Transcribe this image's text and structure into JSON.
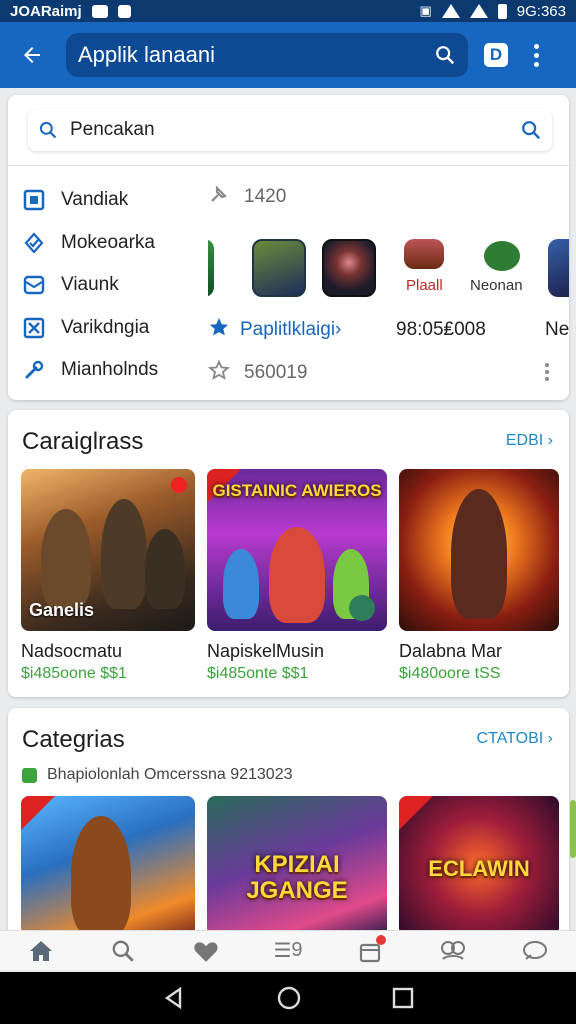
{
  "status_bar": {
    "left_text": "JOARaimj",
    "time": "9G:363"
  },
  "app_bar": {
    "search_value": "Applik lanaani"
  },
  "search_card": {
    "search_value": "Pencakan",
    "menu": [
      {
        "icon": "square-icon",
        "label": "Vandiak"
      },
      {
        "icon": "check-badge-icon",
        "label": "Mokeoarka"
      },
      {
        "icon": "mail-icon",
        "label": "Viaunk"
      },
      {
        "icon": "shuffle-icon",
        "label": "Varikdngia"
      },
      {
        "icon": "wrench-icon",
        "label": "Mianholnds"
      }
    ],
    "stat_top": "1420",
    "app_labels": [
      "Plaall",
      "Neonan"
    ],
    "popular_link": "Paplitlklaigi›",
    "popular_date": "98:05₤008",
    "popular_edge": "Ne",
    "stat_bottom": "560019"
  },
  "section1": {
    "title": "Caraiglrass",
    "link": "EDBI ›",
    "tiles": [
      {
        "name": "Nadsocmatu",
        "price": "$i485oone $$1",
        "caption": "Ganelis",
        "art_title": ""
      },
      {
        "name": "NapiskelMusin",
        "price": "$i485onte $$1",
        "caption": "",
        "art_title": "GISTAINIC AWIEROS"
      },
      {
        "name": "Dalabna Mar",
        "price": "$i480oore tSS",
        "caption": "",
        "art_title": ""
      }
    ]
  },
  "section2": {
    "title": "Categrias",
    "link": "CTATOBI ›",
    "sub": "Bhapiolonlah Omcerssna 9213023",
    "tiles": [
      {
        "art_title": ""
      },
      {
        "art_title": "KPIZIAI JGANGE"
      },
      {
        "art_title": "ECLAWIN"
      }
    ]
  },
  "bottom_nav": [
    {
      "icon": "home-icon"
    },
    {
      "icon": "search-icon"
    },
    {
      "icon": "heart-icon"
    },
    {
      "icon": "list-icon",
      "label": "9"
    },
    {
      "icon": "bag-icon"
    },
    {
      "icon": "friends-icon"
    },
    {
      "icon": "chat-icon"
    }
  ],
  "colors": {
    "primary": "#1767c0",
    "statusbar": "#0c3a70",
    "price": "#3ba33b",
    "link": "#1e88c8"
  }
}
